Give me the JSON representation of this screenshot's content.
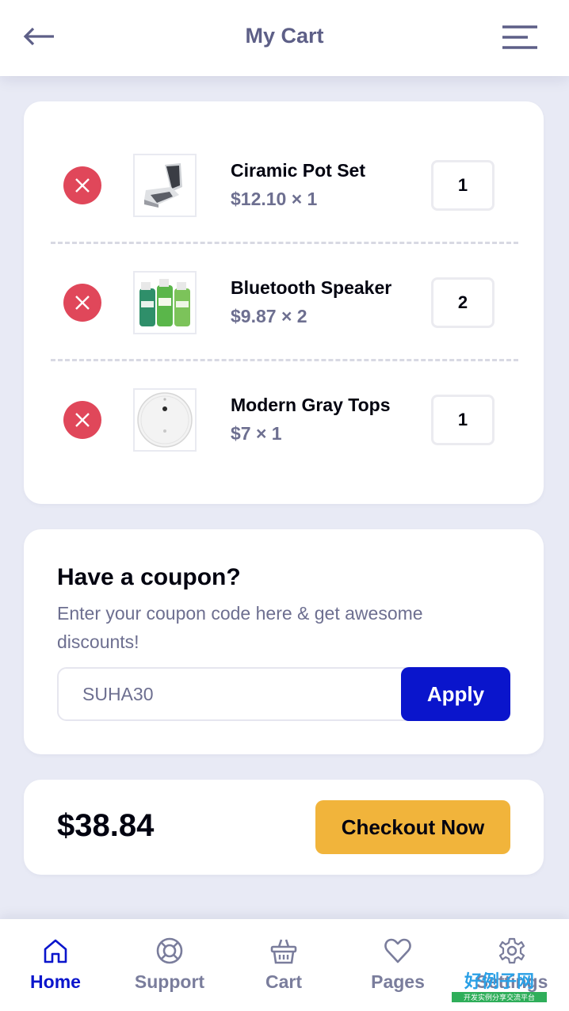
{
  "header": {
    "title": "My Cart"
  },
  "cart": {
    "items": [
      {
        "name": "Ciramic Pot Set",
        "price": "$12.10 × 1",
        "qty": "1",
        "image": "massage-chair-image"
      },
      {
        "name": "Bluetooth Speaker",
        "price": "$9.87 × 2",
        "qty": "2",
        "image": "bottles-image"
      },
      {
        "name": "Modern Gray Tops",
        "price": "$7 × 1",
        "qty": "1",
        "image": "robot-vacuum-image"
      }
    ]
  },
  "coupon": {
    "title": "Have a coupon?",
    "description": "Enter your coupon code here & get awesome discounts!",
    "value": "SUHA30",
    "apply_label": "Apply"
  },
  "checkout": {
    "total": "$38.84",
    "button_label": "Checkout Now"
  },
  "footer_nav": [
    {
      "label": "Home",
      "icon": "home-icon",
      "active": true
    },
    {
      "label": "Support",
      "icon": "lifebuoy-icon"
    },
    {
      "label": "Cart",
      "icon": "basket-icon"
    },
    {
      "label": "Pages",
      "icon": "heart-icon"
    },
    {
      "label": "Settings",
      "icon": "gear-icon"
    }
  ],
  "watermark": {
    "text": "开发实例分享交流平台",
    "logo": "好例子网"
  },
  "colors": {
    "accent": "#0a15cc",
    "danger": "#e0475a",
    "warning": "#f1b43b",
    "background": "#e8eaf5"
  }
}
